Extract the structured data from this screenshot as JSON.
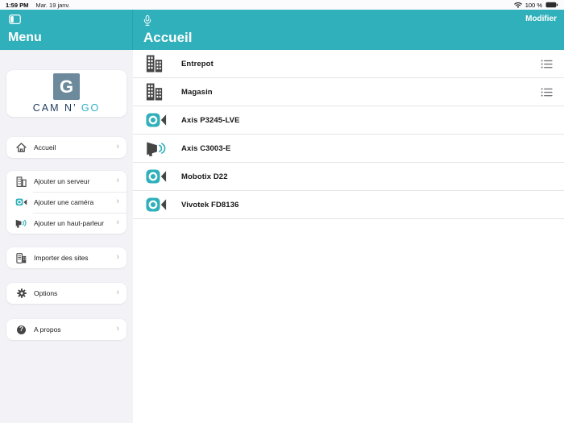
{
  "status_bar": {
    "time": "1:59 PM",
    "date": "Mar. 19 janv.",
    "battery": "100 %"
  },
  "sidebar": {
    "title": "Menu",
    "logo": {
      "monogram": "G",
      "text_primary": "CAM N’",
      "text_secondary": "GO"
    },
    "items": [
      {
        "label": "Accueil",
        "icon": "home-icon"
      },
      {
        "label": "Ajouter un serveur",
        "icon": "building-icon"
      },
      {
        "label": "Ajouter une caméra",
        "icon": "camera-icon"
      },
      {
        "label": "Ajouter un haut-parleur",
        "icon": "megaphone-icon"
      },
      {
        "label": "Importer des sites",
        "icon": "import-sites-icon"
      },
      {
        "label": "Options",
        "icon": "gear-icon"
      },
      {
        "label": "A propos",
        "icon": "question-icon"
      }
    ]
  },
  "header": {
    "title": "Accueil",
    "edit_button": "Modifier",
    "mic_icon": "microphone-icon"
  },
  "list": {
    "items": [
      {
        "label": "Entrepot",
        "icon": "buildings-icon",
        "trailing": "list-bullet-icon"
      },
      {
        "label": "Magasin",
        "icon": "buildings-icon",
        "trailing": "list-bullet-icon"
      },
      {
        "label": "Axis P3245-LVE",
        "icon": "camera-icon",
        "trailing": null
      },
      {
        "label": "Axis C3003-E",
        "icon": "megaphone-icon",
        "trailing": null
      },
      {
        "label": "Mobotix D22",
        "icon": "camera-icon",
        "trailing": null
      },
      {
        "label": "Vivotek FD8136",
        "icon": "camera-icon",
        "trailing": null
      }
    ]
  },
  "colors": {
    "accent_teal": "#30b0ba",
    "icon_dark": "#454545",
    "logo_navy": "#1e3b5c",
    "logo_teal": "#2db0c3",
    "logo_slate": "#6d8a9d",
    "sidebar_bg": "#f2f2f7"
  }
}
